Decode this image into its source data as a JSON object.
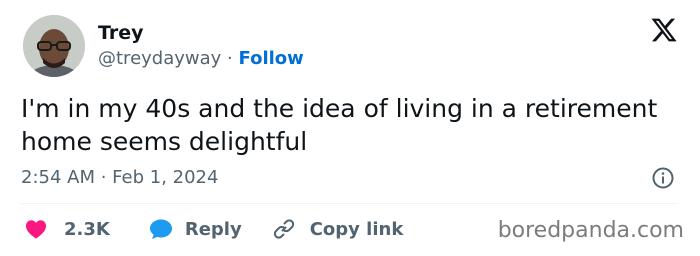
{
  "author": {
    "name": "Trey",
    "handle": "@treydayway",
    "separator": "·",
    "follow_label": "Follow"
  },
  "tweet": {
    "text": "I'm in my 40s and the idea of living in a retirement home seems delightful",
    "timestamp": "2:54 AM · Feb 1, 2024"
  },
  "actions": {
    "likes": "2.3K",
    "reply_label": "Reply",
    "copy_link_label": "Copy link"
  },
  "watermark": "boredpanda.com",
  "icons": {
    "platform": "x-logo-icon",
    "info": "info-icon",
    "like": "heart-icon",
    "reply": "speech-bubble-icon",
    "copy": "link-icon"
  },
  "colors": {
    "heart": "#f91880",
    "reply_bubble": "#1d9bf0",
    "follow": "#006fd6",
    "muted_text": "#536471"
  }
}
